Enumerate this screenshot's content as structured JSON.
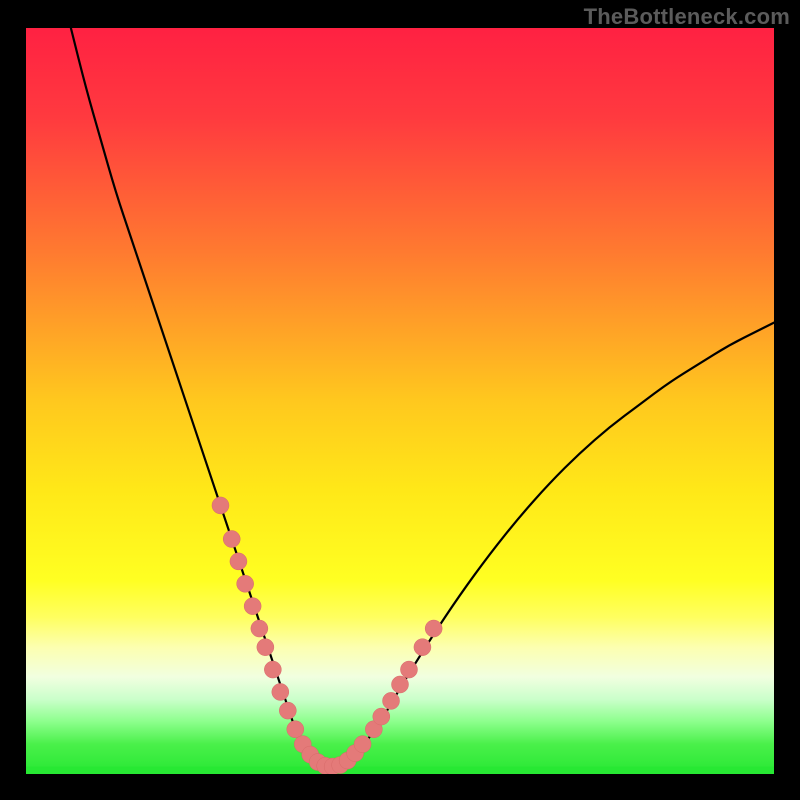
{
  "watermark": "TheBottleneck.com",
  "colors": {
    "curve": "#000000",
    "points": "#e47a79",
    "points_stroke": "#d86a69",
    "green_band": "#27e833",
    "gradient_stops": [
      {
        "offset": "0%",
        "color": "#ff2142"
      },
      {
        "offset": "12%",
        "color": "#ff3a3f"
      },
      {
        "offset": "30%",
        "color": "#ff7a30"
      },
      {
        "offset": "50%",
        "color": "#ffc81e"
      },
      {
        "offset": "62%",
        "color": "#ffe818"
      },
      {
        "offset": "74%",
        "color": "#ffff22"
      },
      {
        "offset": "79%",
        "color": "#ffff60"
      },
      {
        "offset": "83%",
        "color": "#fcffb0"
      },
      {
        "offset": "87%",
        "color": "#f1ffe0"
      },
      {
        "offset": "90%",
        "color": "#caffca"
      },
      {
        "offset": "93%",
        "color": "#8cff8c"
      },
      {
        "offset": "96%",
        "color": "#4af04a"
      },
      {
        "offset": "100%",
        "color": "#27e833"
      }
    ]
  },
  "chart_data": {
    "type": "line",
    "title": "",
    "xlabel": "",
    "ylabel": "",
    "xlim": [
      0,
      100
    ],
    "ylim": [
      0,
      100
    ],
    "curve": {
      "x": [
        6,
        8,
        10,
        12,
        14,
        16,
        18,
        20,
        22,
        24,
        26,
        28,
        29,
        30,
        31,
        32,
        33,
        34,
        35,
        36,
        37,
        38,
        39,
        40,
        42,
        44,
        46,
        48,
        50,
        54,
        58,
        62,
        66,
        70,
        74,
        78,
        82,
        86,
        90,
        94,
        98,
        100
      ],
      "y": [
        100,
        92,
        85,
        78,
        72,
        66,
        60,
        54,
        48,
        42,
        36,
        30,
        27,
        24,
        21,
        18,
        15,
        12,
        9,
        6,
        4,
        2.5,
        1.5,
        1,
        1,
        2.5,
        5,
        8,
        11.5,
        18,
        24,
        29.5,
        34.5,
        39,
        43,
        46.5,
        49.5,
        52.5,
        55,
        57.5,
        59.5,
        60.5
      ]
    },
    "highlight_points": {
      "x": [
        26,
        27.5,
        28.4,
        29.3,
        30.3,
        31.2,
        32,
        33,
        34,
        35,
        36,
        37,
        38,
        39,
        40,
        41,
        42,
        43,
        44,
        45,
        46.5,
        47.5,
        48.8,
        50,
        51.2,
        53,
        54.5
      ],
      "y": [
        36,
        31.5,
        28.5,
        25.5,
        22.5,
        19.5,
        17,
        14,
        11,
        8.5,
        6,
        4,
        2.6,
        1.6,
        1.1,
        1,
        1.2,
        1.8,
        2.8,
        4,
        6,
        7.7,
        9.8,
        12,
        14,
        17,
        19.5
      ]
    }
  }
}
